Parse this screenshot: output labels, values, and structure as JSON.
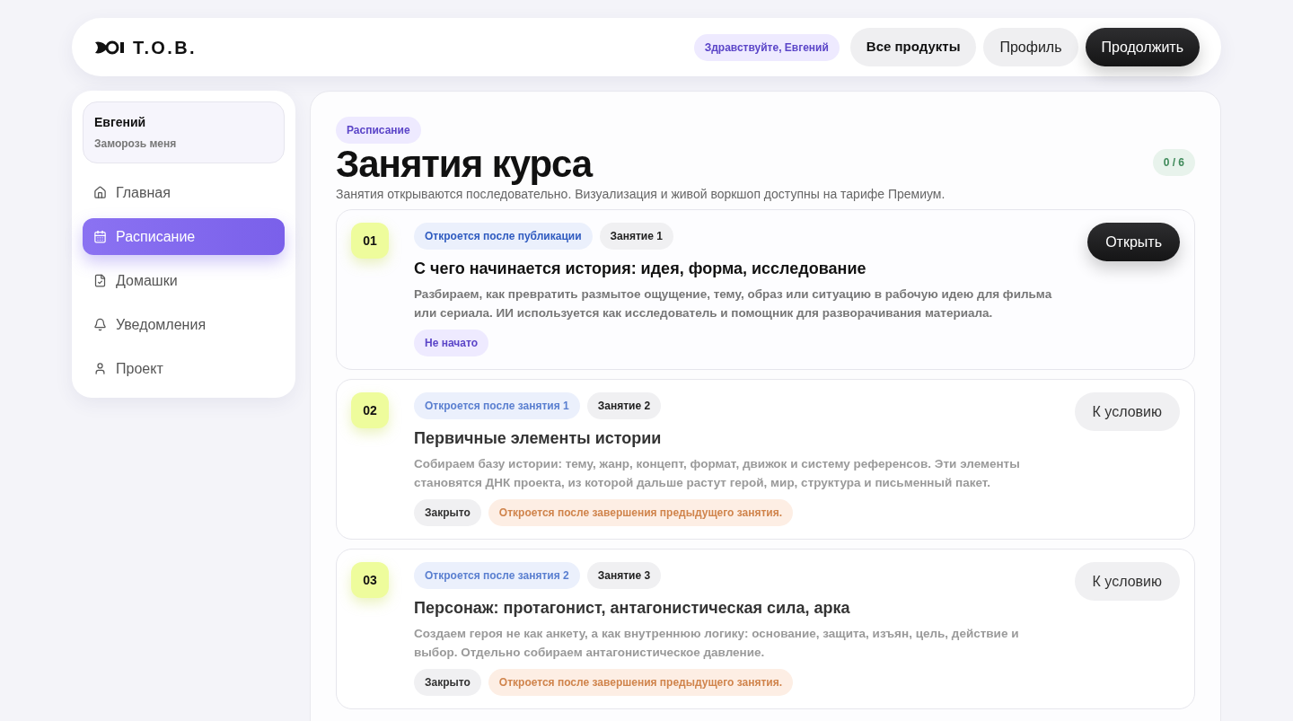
{
  "header": {
    "logo_text": "T.O.B.",
    "greeting": "Здравствуйте, Евгений",
    "buttons": [
      {
        "label": "Все продукты",
        "kind": "bold"
      },
      {
        "label": "Профиль",
        "kind": "plain"
      },
      {
        "label": "Продолжить",
        "kind": "primary"
      }
    ]
  },
  "sidebar": {
    "user": {
      "name": "Евгений",
      "subtitle": "Заморозь меня"
    },
    "items": [
      {
        "label": "Главная",
        "kind": "home",
        "selected": false
      },
      {
        "label": "Расписание",
        "kind": "calendar",
        "selected": true
      },
      {
        "label": "Домашки",
        "kind": "file",
        "selected": false
      },
      {
        "label": "Уведомления",
        "kind": "bell",
        "selected": false
      },
      {
        "label": "Проект",
        "kind": "user",
        "selected": false
      }
    ]
  },
  "main": {
    "section_tag": "Расписание",
    "title": "Занятия курса",
    "progress": "0 / 6",
    "subtitle": "Занятия открываются последовательно. Визуализация и живой воркшоп доступны на тарифе Премиум.",
    "lessons": [
      {
        "number": "01",
        "unlock": "Откроется после публикации",
        "lesson": "Занятие 1",
        "title": "С чего начинается история: идея, форма, исследование",
        "description": "Разбираем, как превратить размытое ощущение, тему, образ или ситуацию в рабочую идею для фильма или сериала. ИИ используется как исследователь и помощник для разворачивания материала.",
        "locked": false,
        "tags": [
          {
            "label": "Не начато",
            "kind": "status"
          }
        ],
        "action": {
          "label": "Открыть",
          "kind": "primary"
        }
      },
      {
        "number": "02",
        "unlock": "Откроется после занятия 1",
        "lesson": "Занятие 2",
        "title": "Первичные элементы истории",
        "description": "Собираем базу истории: тему, жанр, концепт, формат, движок и систему референсов. Эти элементы становятся ДНК проекта, из которой дальше растут герой, мир, структура и письменный пакет.",
        "locked": true,
        "tags": [
          {
            "label": "Закрыто",
            "kind": "closed"
          },
          {
            "label": "Откроется после завершения предыдущего занятия.",
            "kind": "note"
          }
        ],
        "action": {
          "label": "К условию",
          "kind": "secondary"
        }
      },
      {
        "number": "03",
        "unlock": "Откроется после занятия 2",
        "lesson": "Занятие 3",
        "title": "Персонаж: протагонист, антагонистическая сила, арка",
        "description": "Создаем героя не как анкету, а как внутреннюю логику: основание, защита, изъян, цель, действие и выбор. Отдельно собираем антагонистическое давление.",
        "locked": true,
        "tags": [
          {
            "label": "Закрыто",
            "kind": "closed"
          },
          {
            "label": "Откроется после завершения предыдущего занятия.",
            "kind": "note"
          }
        ],
        "action": {
          "label": "К условию",
          "kind": "secondary"
        }
      }
    ]
  }
}
